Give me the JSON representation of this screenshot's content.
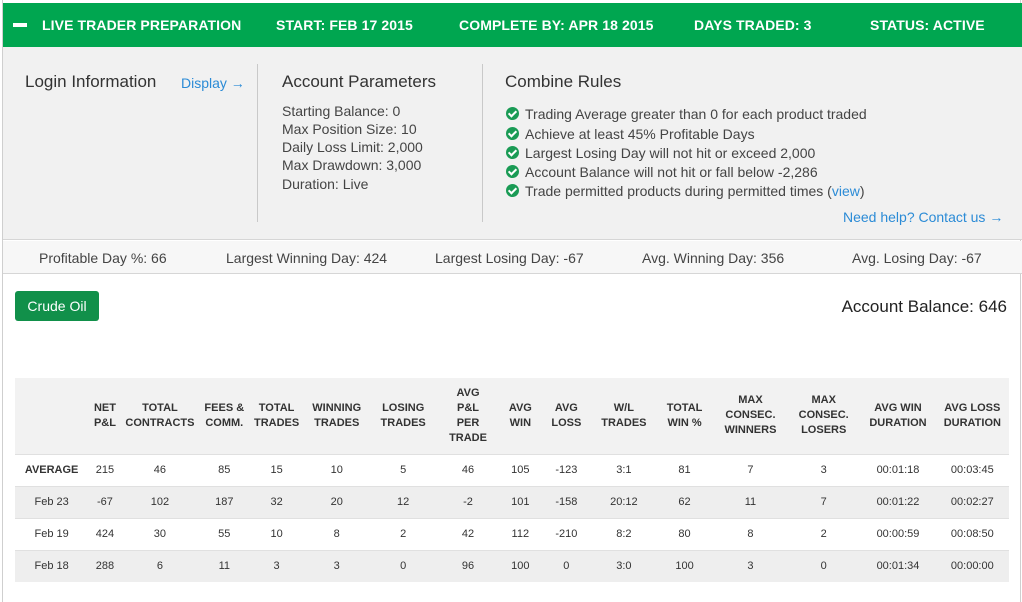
{
  "header": {
    "title": "LIVE TRADER PREPARATION",
    "start": "START: FEB 17 2015",
    "complete_by": "COMPLETE BY: APR 18 2015",
    "days_traded": "DAYS TRADED: 3",
    "status": "STATUS: ACTIVE"
  },
  "login": {
    "title": "Login Information",
    "display_link": "Display →"
  },
  "account_params": {
    "title": "Account Parameters",
    "items": [
      "Starting Balance: 0",
      "Max Position Size: 10",
      "Daily Loss Limit: 2,000",
      "Max Drawdown: 3,000",
      "Duration: Live"
    ]
  },
  "combine_rules": {
    "title": "Combine Rules",
    "items": [
      "Trading Average greater than 0 for each product traded",
      "Achieve at least 45% Profitable Days",
      "Largest Losing Day will not hit or exceed 2,000",
      "Account Balance will not hit or fall below -2,286",
      "Trade permitted products during permitted times"
    ],
    "open_paren": " (",
    "view_link": "view",
    "close_paren": ")",
    "help_link": "Need help? Contact us →"
  },
  "stats": {
    "profitable_day": "Profitable Day %: 66",
    "largest_winning": "Largest Winning Day: 424",
    "largest_losing": "Largest Losing Day: -67",
    "avg_winning": "Avg. Winning Day: 356",
    "avg_losing": "Avg. Losing Day: -67"
  },
  "product_button": "Crude Oil",
  "account_balance": "Account Balance: 646",
  "table": {
    "headers": [
      [
        ""
      ],
      [
        "NET",
        "P&L"
      ],
      [
        "TOTAL",
        "CONTRACTS"
      ],
      [
        "FEES &",
        "COMM."
      ],
      [
        "TOTAL",
        "TRADES"
      ],
      [
        "WINNING",
        "TRADES"
      ],
      [
        "LOSING",
        "TRADES"
      ],
      [
        "AVG",
        "P&L",
        "PER",
        "TRADE"
      ],
      [
        "AVG",
        "WIN"
      ],
      [
        "AVG",
        "LOSS"
      ],
      [
        "W/L",
        "TRADES"
      ],
      [
        "TOTAL",
        "WIN %"
      ],
      [
        "MAX",
        "CONSEC.",
        "WINNERS"
      ],
      [
        "MAX",
        "CONSEC.",
        "LOSERS"
      ],
      [
        "AVG WIN",
        "DURATION"
      ],
      [
        "AVG LOSS",
        "DURATION"
      ]
    ],
    "rows": [
      [
        "AVERAGE",
        "215",
        "46",
        "85",
        "15",
        "10",
        "5",
        "46",
        "105",
        "-123",
        "3:1",
        "81",
        "7",
        "3",
        "00:01:18",
        "00:03:45"
      ],
      [
        "Feb 23",
        "-67",
        "102",
        "187",
        "32",
        "20",
        "12",
        "-2",
        "101",
        "-158",
        "20:12",
        "62",
        "11",
        "7",
        "00:01:22",
        "00:02:27"
      ],
      [
        "Feb 19",
        "424",
        "30",
        "55",
        "10",
        "8",
        "2",
        "42",
        "112",
        "-210",
        "8:2",
        "80",
        "8",
        "2",
        "00:00:59",
        "00:08:50"
      ],
      [
        "Feb 18",
        "288",
        "6",
        "11",
        "3",
        "3",
        "0",
        "96",
        "100",
        "0",
        "3:0",
        "100",
        "3",
        "0",
        "00:01:34",
        "00:00:00"
      ]
    ]
  }
}
